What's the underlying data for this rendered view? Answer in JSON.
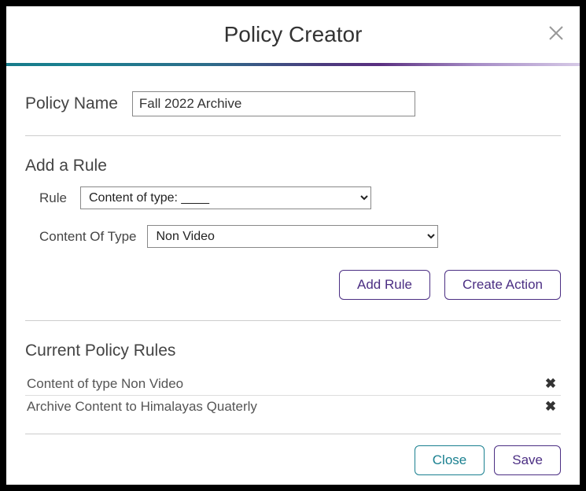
{
  "dialog": {
    "title": "Policy Creator"
  },
  "policy_name": {
    "label": "Policy Name",
    "value": "Fall 2022 Archive"
  },
  "add_rule": {
    "heading": "Add a Rule",
    "rule_label": "Rule",
    "rule_select": "Content of type: ____",
    "content_type_label": "Content Of Type",
    "content_type_select": "Non Video",
    "buttons": {
      "add_rule": "Add Rule",
      "create_action": "Create Action"
    }
  },
  "current_rules": {
    "heading": "Current Policy Rules",
    "items": [
      {
        "text": "Content of type Non Video"
      },
      {
        "text": "Archive Content to Himalayas Quaterly"
      }
    ]
  },
  "footer": {
    "close": "Close",
    "save": "Save"
  }
}
